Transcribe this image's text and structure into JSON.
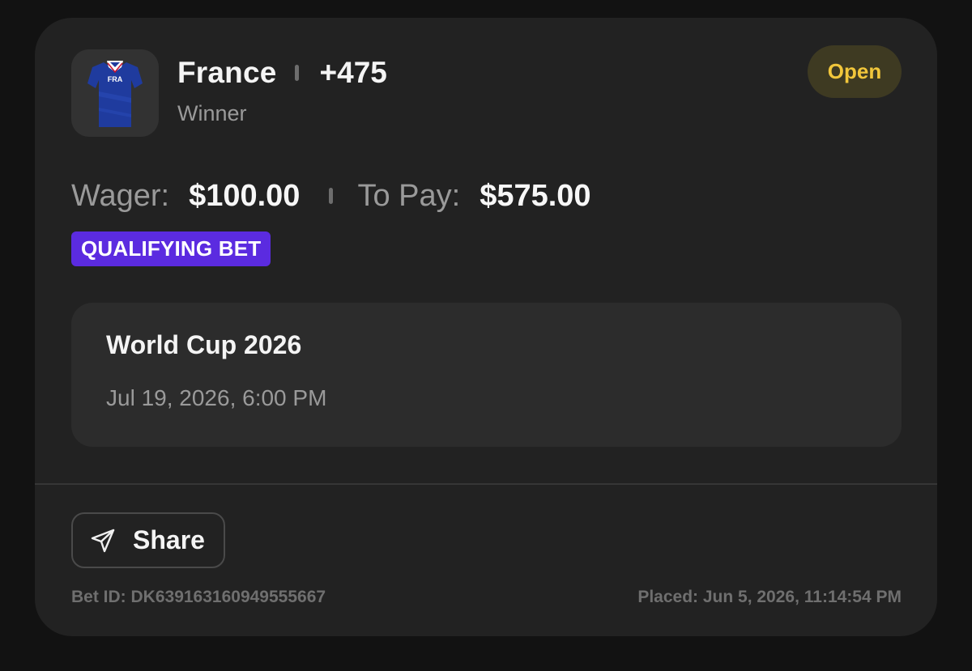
{
  "bet": {
    "team": "France",
    "odds": "+475",
    "market": "Winner",
    "status": "Open",
    "jersey_code": "FRA"
  },
  "amounts": {
    "wager_label": "Wager:",
    "wager_value": "$100.00",
    "to_pay_label": "To Pay:",
    "to_pay_value": "$575.00"
  },
  "badge": {
    "label": "QUALIFYING BET"
  },
  "event": {
    "name": "World Cup 2026",
    "date": "Jul 19, 2026, 6:00 PM"
  },
  "actions": {
    "share_label": "Share",
    "share_icon": "send-icon"
  },
  "footer": {
    "bet_id": "Bet ID: DK639163160949555667",
    "placed": "Placed: Jun 5, 2026, 11:14:54 PM"
  },
  "colors": {
    "background": "#121212",
    "card": "#222222",
    "status_text": "#f1c63b",
    "status_bg": "#3e3a22",
    "qualifying_bg": "#5b2be0",
    "jersey_blue": "#1e3a9f"
  }
}
